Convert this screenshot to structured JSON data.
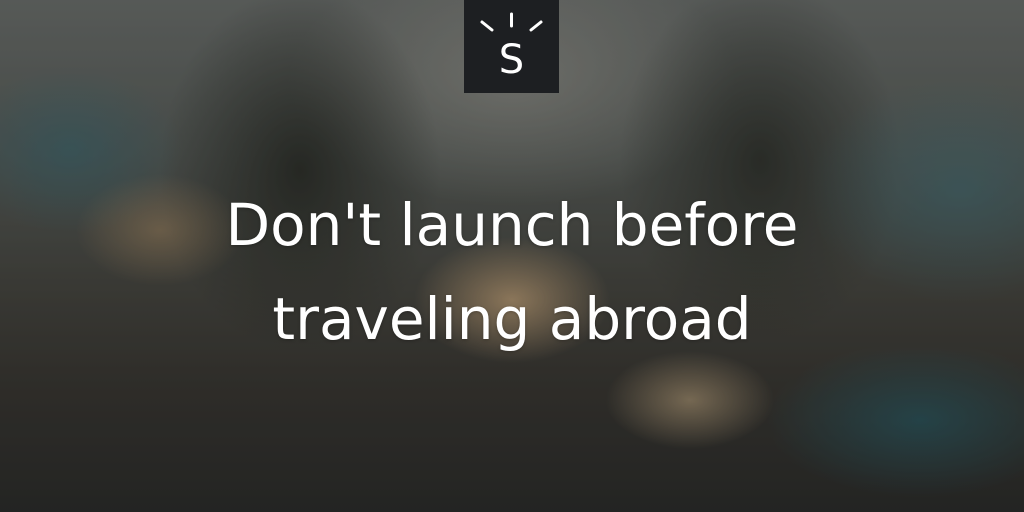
{
  "logo": {
    "letter": "S",
    "icon": "sunrise-s-logo-icon",
    "background": "#1d1f22"
  },
  "headline": {
    "line1": "Don't launch before",
    "line2": "traveling abroad"
  },
  "background": {
    "description_icon": "blurred-resort-photo"
  }
}
